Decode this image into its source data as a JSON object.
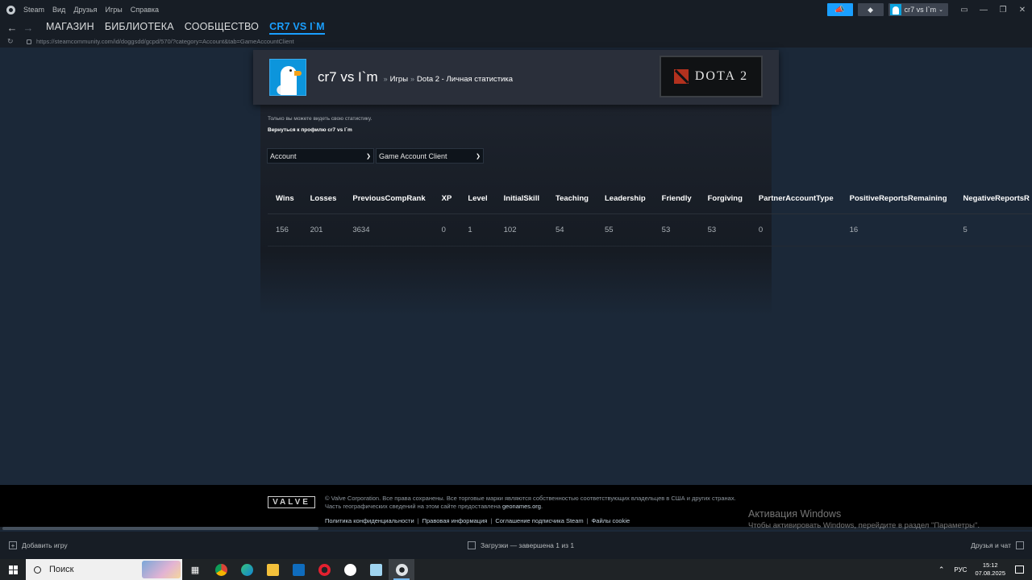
{
  "topbar": {
    "menu": [
      "Steam",
      "Вид",
      "Друзья",
      "Игры",
      "Справка"
    ],
    "username": "cr7 vs I`m"
  },
  "nav": {
    "tabs": [
      "МАГАЗИН",
      "БИБЛИОТЕКА",
      "СООБЩЕСТВО",
      "CR7 VS I`M"
    ],
    "active_tab_index": 3,
    "url": "https://steamcommunity.com/id/doggsdd/gcpd/570/?category=Account&tab=GameAccountClient"
  },
  "profile": {
    "name": "cr7 vs I`m",
    "crumb_games": "Игры",
    "crumb_separator": "»",
    "crumb_stats": "Dota 2 - Личная статистика",
    "game_logo_text": "DOTA 2"
  },
  "page": {
    "notice": "Только вы можете видеть свою статистику.",
    "back_link": "Вернуться к профилю cr7 vs I`m",
    "select_category": "Account",
    "select_tab": "Game Account Client"
  },
  "table": {
    "headers": [
      "Wins",
      "Losses",
      "PreviousCompRank",
      "XP",
      "Level",
      "InitialSkill",
      "Teaching",
      "Leadership",
      "Friendly",
      "Forgiving",
      "PartnerAccountType",
      "PositiveReportsRemaining",
      "NegativeReportsR"
    ],
    "rows": [
      [
        "156",
        "201",
        "3634",
        "0",
        "1",
        "102",
        "54",
        "55",
        "53",
        "53",
        "0",
        "16",
        "5"
      ]
    ]
  },
  "footer": {
    "valve_logo": "VALVE",
    "legal_line1": "© Valve Corporation. Все права сохранены. Все торговые марки являются собственностью соответствующих владельцев в США и других странах.",
    "legal_line2": "Часть географических сведений на этом сайте предоставлена",
    "legal_geonames": "geonames.org",
    "links": [
      "Политика конфиденциальности",
      "Правовая информация",
      "Соглашение подписчика Steam",
      "Файлы cookie"
    ]
  },
  "activation": {
    "title": "Активация Windows",
    "subtitle": "Чтобы активировать Windows, перейдите в раздел \"Параметры\"."
  },
  "bottombar": {
    "add_game": "Добавить игру",
    "downloads": "Загрузки — завершена 1 из 1",
    "friends": "Друзья и чат"
  },
  "taskbar": {
    "search": "Поиск",
    "lang": "РУС",
    "time": "15:12",
    "date": "07.08.2025"
  },
  "colors": {
    "accent": "#1a9fff",
    "background": "#1b2838"
  }
}
